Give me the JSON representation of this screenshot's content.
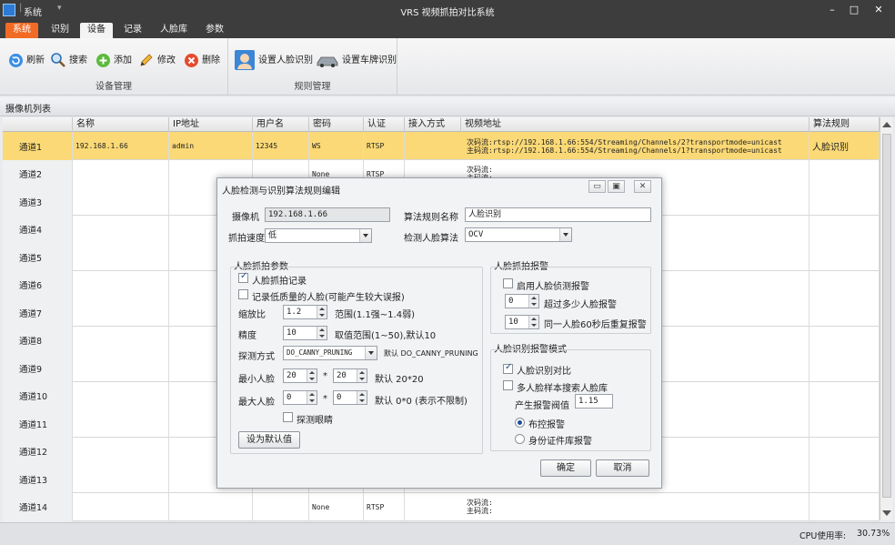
{
  "window": {
    "app_label": "系统",
    "title": "VRS 视频抓拍对比系统",
    "controls": {
      "minimize": "–",
      "maximize": "□",
      "close": "✕"
    }
  },
  "menu": {
    "tabs": [
      "系统",
      "识别",
      "设备",
      "记录",
      "人脸库",
      "参数"
    ],
    "active": "设备"
  },
  "ribbon": {
    "device_group": {
      "label": "设备管理",
      "buttons": {
        "refresh": "刷新",
        "search": "搜索",
        "add": "添加",
        "edit": "修改",
        "delete": "删除"
      }
    },
    "rule_group": {
      "label": "规则管理",
      "buttons": {
        "face_rule": "设置人脸识别",
        "plate_rule": "设置车牌识别"
      }
    }
  },
  "list_title": "摄像机列表",
  "table": {
    "columns": [
      "名称",
      "IP地址",
      "用户名",
      "密码",
      "认证",
      "接入方式",
      "视频地址",
      "算法规则"
    ],
    "rows": [
      {
        "name": "通道1",
        "ip": "192.168.1.66",
        "user": "admin",
        "pwd": "12345",
        "auth": "WS",
        "access": "RTSP",
        "sub": "次码流:rtsp://192.168.1.66:554/Streaming/Channels/2?transportmode=unicast",
        "main": "主码流:rtsp://192.168.1.66:554/Streaming/Channels/1?transportmode=unicast",
        "algo": "人脸识别",
        "selected": true
      },
      {
        "name": "通道2",
        "ip": "",
        "user": "",
        "pwd": "",
        "auth": "None",
        "access": "RTSP",
        "sub": "次码流:",
        "main": "主码流:",
        "algo": ""
      },
      {
        "name": "通道3",
        "ip": "",
        "user": "",
        "pwd": "",
        "auth": "",
        "access": "",
        "sub": "",
        "main": "",
        "algo": ""
      },
      {
        "name": "通道4",
        "ip": "",
        "user": "",
        "pwd": "",
        "auth": "",
        "access": "",
        "sub": "",
        "main": "",
        "algo": ""
      },
      {
        "name": "通道5",
        "ip": "",
        "user": "",
        "pwd": "",
        "auth": "",
        "access": "",
        "sub": "",
        "main": "",
        "algo": ""
      },
      {
        "name": "通道6",
        "ip": "",
        "user": "",
        "pwd": "",
        "auth": "",
        "access": "",
        "sub": "",
        "main": "",
        "algo": ""
      },
      {
        "name": "通道7",
        "ip": "",
        "user": "",
        "pwd": "",
        "auth": "",
        "access": "",
        "sub": "",
        "main": "",
        "algo": ""
      },
      {
        "name": "通道8",
        "ip": "",
        "user": "",
        "pwd": "",
        "auth": "",
        "access": "",
        "sub": "",
        "main": "",
        "algo": ""
      },
      {
        "name": "通道9",
        "ip": "",
        "user": "",
        "pwd": "",
        "auth": "",
        "access": "",
        "sub": "",
        "main": "",
        "algo": ""
      },
      {
        "name": "通道10",
        "ip": "",
        "user": "",
        "pwd": "",
        "auth": "",
        "access": "",
        "sub": "",
        "main": "",
        "algo": ""
      },
      {
        "name": "通道11",
        "ip": "",
        "user": "",
        "pwd": "",
        "auth": "",
        "access": "",
        "sub": "",
        "main": "",
        "algo": ""
      },
      {
        "name": "通道12",
        "ip": "",
        "user": "",
        "pwd": "",
        "auth": "",
        "access": "",
        "sub": "",
        "main": "",
        "algo": ""
      },
      {
        "name": "通道13",
        "ip": "",
        "user": "",
        "pwd": "",
        "auth": "",
        "access": "",
        "sub": "",
        "main": "",
        "algo": ""
      },
      {
        "name": "通道14",
        "ip": "",
        "user": "",
        "pwd": "",
        "auth": "None",
        "access": "RTSP",
        "sub": "次码流:",
        "main": "主码流:",
        "algo": ""
      }
    ]
  },
  "status": {
    "cpu_label": "CPU使用率:",
    "cpu_value": "30.73%"
  },
  "dialog": {
    "title": "人脸检测与识别算法规则编辑",
    "camera_label": "摄像机",
    "camera_value": "192.168.1.66",
    "rule_name_label": "算法规则名称",
    "rule_name_value": "人脸识别",
    "speed_label": "抓拍速度",
    "speed_value": "低",
    "detect_algo_label": "检测人脸算法",
    "detect_algo_value": "OCV",
    "capture": {
      "title": "人脸抓拍参数",
      "record_label": "人脸抓拍记录",
      "record_checked": true,
      "lowq_label": "记录低质量的人脸(可能产生较大误报)",
      "lowq_checked": false,
      "scale_label": "缩放比",
      "scale_value": "1.2",
      "scale_hint": "范围(1.1强~1.4弱)",
      "precision_label": "精度",
      "precision_value": "10",
      "precision_hint": "取值范围(1~50),默认10",
      "mode_label": "探测方式",
      "mode_value": "DO_CANNY_PRUNING",
      "mode_hint": "默认 DO_CANNY_PRUNING",
      "min_label": "最小人脸",
      "min_w": "20",
      "min_h": "20",
      "min_hint": "默认 20*20",
      "max_label": "最大人脸",
      "max_w": "0",
      "max_h": "0",
      "max_hint": "默认 0*0 (表示不限制)",
      "times": "*",
      "eyes_label": "探测眼睛",
      "eyes_checked": false,
      "default_btn": "设为默认值"
    },
    "alarm": {
      "title": "人脸抓拍报警",
      "enable_label": "启用人脸侦测报警",
      "enable_checked": false,
      "count_value": "0",
      "count_label": "超过多少人脸报警",
      "repeat_value": "10",
      "repeat_label": "同一人脸60秒后重复报警"
    },
    "recog": {
      "title": "人脸识别报警模式",
      "compare_label": "人脸识别对比",
      "compare_checked": true,
      "multi_label": "多人脸样本搜索人脸库",
      "multi_checked": false,
      "threshold_label": "产生报警阀值",
      "threshold_value": "1.15",
      "opt1": "布控报警",
      "opt2": "身份证件库报警",
      "selected": "布控报警"
    },
    "ok": "确定",
    "cancel": "取消",
    "ctrl_min": "▭",
    "ctrl_restore": "▣",
    "ctrl_close": "✕"
  }
}
